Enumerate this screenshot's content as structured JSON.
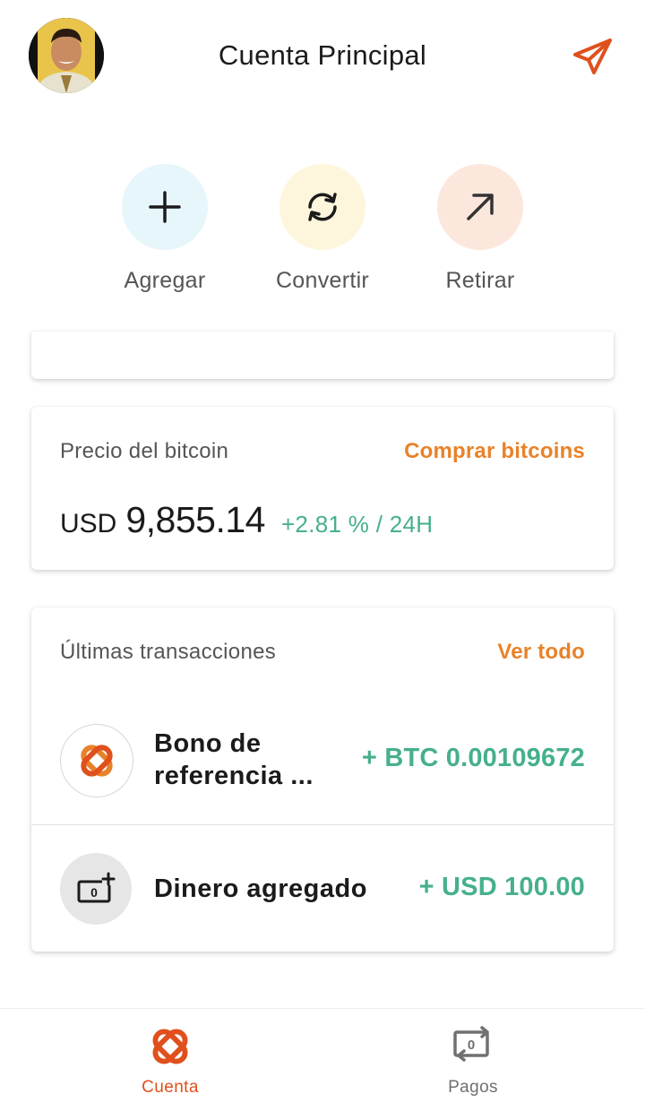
{
  "header": {
    "title": "Cuenta Principal",
    "avatar_icon": "avatar-photo",
    "send_icon": "paper-plane-icon"
  },
  "actions": [
    {
      "label": "Agregar",
      "icon": "plus-icon",
      "bg": "#e6f6fb"
    },
    {
      "label": "Convertir",
      "icon": "refresh-icon",
      "bg": "#fdf6dc"
    },
    {
      "label": "Retirar",
      "icon": "arrow-up-right-icon",
      "bg": "#fce7dc"
    }
  ],
  "price_card": {
    "heading": "Precio del bitcoin",
    "link": "Comprar bitcoins",
    "currency": "USD",
    "price": "9,855.14",
    "change": "+2.81 % / 24H"
  },
  "transactions_card": {
    "heading": "Últimas transacciones",
    "link": "Ver todo",
    "items": [
      {
        "name_line1": "Bono de",
        "name_line2": "referencia ...",
        "amount": "+ BTC 0.00109672",
        "icon": "brand-logo-icon"
      },
      {
        "name": "Dinero agregado",
        "amount": "+ USD 100.00",
        "icon": "cash-add-icon"
      }
    ]
  },
  "bottom_nav": [
    {
      "label": "Cuenta",
      "active": true,
      "icon": "brand-logo-icon"
    },
    {
      "label": "Pagos",
      "active": false,
      "icon": "payments-icon"
    }
  ],
  "colors": {
    "accent_orange": "#e8822a",
    "brand_red": "#e0501d",
    "positive_green": "#46b08a"
  }
}
